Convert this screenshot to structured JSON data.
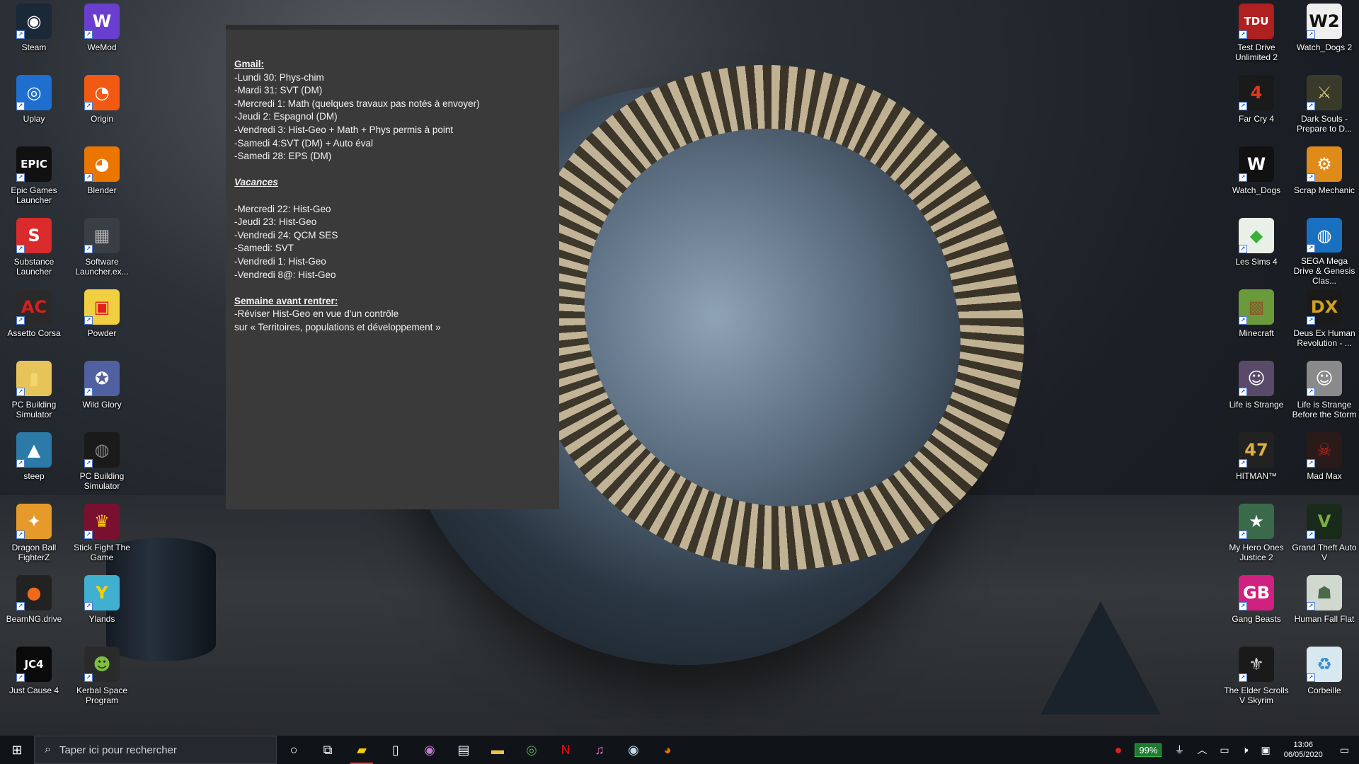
{
  "note": {
    "lines": [
      {
        "text": "Gmail:",
        "style": "h"
      },
      {
        "text": "-Lundi 30: Phys-chim",
        "style": ""
      },
      {
        "text": "-Mardi 31: SVT (DM)",
        "style": ""
      },
      {
        "text": "-Mercredi 1: Math (quelques travaux pas notés à envoyer)",
        "style": ""
      },
      {
        "text": "-Jeudi 2: Espagnol (DM)",
        "style": ""
      },
      {
        "text": "-Vendredi 3: Hist-Geo + Math + Phys permis à point",
        "style": ""
      },
      {
        "text": "-Samedi 4:SVT (DM) + Auto éval",
        "style": ""
      },
      {
        "text": "-Samedi 28: EPS (DM)",
        "style": ""
      },
      {
        "text": "",
        "style": "gap"
      },
      {
        "text": "Vacances",
        "style": "h hi"
      },
      {
        "text": "",
        "style": "gap"
      },
      {
        "text": "-Mercredi 22: Hist-Geo",
        "style": ""
      },
      {
        "text": "-Jeudi 23: Hist-Geo",
        "style": ""
      },
      {
        "text": "-Vendredi 24: QCM SES",
        "style": ""
      },
      {
        "text": "-Samedi: SVT",
        "style": ""
      },
      {
        "text": "-Vendredi 1: Hist-Geo",
        "style": ""
      },
      {
        "text": "-Vendredi 8@: Hist-Geo",
        "style": ""
      },
      {
        "text": "",
        "style": "gap"
      },
      {
        "text": "Semaine avant rentrer:",
        "style": "h"
      },
      {
        "text": "-Réviser Hist-Geo en vue d'un contrôle",
        "style": ""
      },
      {
        "text": "sur « Territoires, populations et développement »",
        "style": ""
      }
    ]
  },
  "desktop": {
    "col1": [
      {
        "label": "Steam",
        "icon": "steam-icon",
        "glyph": "◉",
        "bg": "#1b2838",
        "fg": "#ffffff"
      },
      {
        "label": "Uplay",
        "icon": "uplay-icon",
        "glyph": "◎",
        "bg": "#1e6fd0",
        "fg": "#ffffff"
      },
      {
        "label": "Epic Games Launcher",
        "icon": "epic-games-icon",
        "glyph": "EPIC",
        "bg": "#111111",
        "fg": "#ffffff"
      },
      {
        "label": "Substance Launcher",
        "icon": "substance-icon",
        "glyph": "S",
        "bg": "#d92b2b",
        "fg": "#ffffff"
      },
      {
        "label": "Assetto Corsa",
        "icon": "assetto-corsa-icon",
        "glyph": "AC",
        "bg": "#2a2a2a",
        "fg": "#d42020"
      },
      {
        "label": "PC Building Simulator",
        "icon": "folder-icon",
        "glyph": "▮",
        "bg": "#e7c45a",
        "fg": "#f5d66e"
      },
      {
        "label": "steep",
        "icon": "steep-icon",
        "glyph": "▲",
        "bg": "#2c7aa8",
        "fg": "#ffffff"
      },
      {
        "label": "Dragon Ball FighterZ",
        "icon": "dragon-ball-icon",
        "glyph": "✦",
        "bg": "#e69a2a",
        "fg": "#ffffff"
      },
      {
        "label": "BeamNG.drive",
        "icon": "beamng-icon",
        "glyph": "●",
        "bg": "#222222",
        "fg": "#f06a1a"
      },
      {
        "label": "Just Cause 4",
        "icon": "just-cause-icon",
        "glyph": "JC4",
        "bg": "#0a0a0a",
        "fg": "#ffffff"
      }
    ],
    "col2": [
      {
        "label": "WeMod",
        "icon": "wemod-icon",
        "glyph": "W",
        "bg": "#6a3fd0",
        "fg": "#ffffff"
      },
      {
        "label": "Origin",
        "icon": "origin-icon",
        "glyph": "◔",
        "bg": "#f25a14",
        "fg": "#ffffff"
      },
      {
        "label": "Blender",
        "icon": "blender-icon",
        "glyph": "◕",
        "bg": "#ea7600",
        "fg": "#ffffff"
      },
      {
        "label": "Software Launcher.ex...",
        "icon": "software-launcher-icon",
        "glyph": "▦",
        "bg": "#3a3f45",
        "fg": "#bbbbbb"
      },
      {
        "label": "Powder",
        "icon": "powder-icon",
        "glyph": "▣",
        "bg": "#f0d040",
        "fg": "#e02020"
      },
      {
        "label": "Wild Glory",
        "icon": "wild-glory-icon",
        "glyph": "✪",
        "bg": "#5060a0",
        "fg": "#ffffff"
      },
      {
        "label": "PC Building Simulator",
        "icon": "pc-building-icon",
        "glyph": "◍",
        "bg": "#1a1a1a",
        "fg": "#888888"
      },
      {
        "label": "Stick Fight The Game",
        "icon": "stick-fight-icon",
        "glyph": "♛",
        "bg": "#7a1030",
        "fg": "#ffcc00"
      },
      {
        "label": "Ylands",
        "icon": "ylands-icon",
        "glyph": "Y",
        "bg": "#3fb0d0",
        "fg": "#ffd000"
      },
      {
        "label": "Kerbal Space Program",
        "icon": "kerbal-icon",
        "glyph": "☻",
        "bg": "#2a2a2a",
        "fg": "#7cc040"
      }
    ],
    "col3": [
      {
        "label": "Test Drive Unlimited 2",
        "icon": "test-drive-icon",
        "glyph": "TDU",
        "bg": "#b02020",
        "fg": "#ffffff"
      },
      {
        "label": "Far Cry 4",
        "icon": "far-cry-icon",
        "glyph": "4",
        "bg": "#1a1a1a",
        "fg": "#e23a1a"
      },
      {
        "label": "Watch_Dogs",
        "icon": "watch-dogs-icon",
        "glyph": "W",
        "bg": "#111111",
        "fg": "#ffffff"
      },
      {
        "label": "Les Sims 4",
        "icon": "sims-icon",
        "glyph": "◆",
        "bg": "#e8f0e8",
        "fg": "#3ab03a"
      },
      {
        "label": "Minecraft",
        "icon": "minecraft-icon",
        "glyph": "▩",
        "bg": "#6a9a3a",
        "fg": "#8a5a2a"
      },
      {
        "label": "Life is Strange",
        "icon": "life-is-strange-icon",
        "glyph": "☺",
        "bg": "#5a4a6a",
        "fg": "#ffffff"
      },
      {
        "label": "HITMAN™",
        "icon": "hitman-icon",
        "glyph": "47",
        "bg": "#222222",
        "fg": "#e0b040"
      },
      {
        "label": "My Hero Ones Justice 2",
        "icon": "my-hero-icon",
        "glyph": "★",
        "bg": "#3a6a4a",
        "fg": "#ffffff"
      },
      {
        "label": "Gang Beasts",
        "icon": "gang-beasts-icon",
        "glyph": "GB",
        "bg": "#d02080",
        "fg": "#ffffff"
      },
      {
        "label": "The Elder Scrolls V Skyrim",
        "icon": "skyrim-icon",
        "glyph": "⚜",
        "bg": "#1a1a1a",
        "fg": "#dddddd"
      }
    ],
    "col4": [
      {
        "label": "Watch_Dogs 2",
        "icon": "watch-dogs-2-icon",
        "glyph": "W2",
        "bg": "#eeeeee",
        "fg": "#111111"
      },
      {
        "label": "Dark Souls - Prepare to D...",
        "icon": "dark-souls-icon",
        "glyph": "⚔",
        "bg": "#3a3a2a",
        "fg": "#d0c080"
      },
      {
        "label": "Scrap Mechanic",
        "icon": "scrap-mechanic-icon",
        "glyph": "⚙",
        "bg": "#e08a1a",
        "fg": "#ffffff"
      },
      {
        "label": "SEGA Mega Drive & Genesis Clas...",
        "icon": "sega-icon",
        "glyph": "◍",
        "bg": "#1a70c0",
        "fg": "#ffffff"
      },
      {
        "label": "Deus Ex Human Revolution - ...",
        "icon": "deus-ex-icon",
        "glyph": "DX",
        "bg": "#1a1a1a",
        "fg": "#d0a020"
      },
      {
        "label": "Life is Strange Before the Storm",
        "icon": "life-is-strange-bts-icon",
        "glyph": "☺",
        "bg": "#8a8a8a",
        "fg": "#ffffff"
      },
      {
        "label": "Mad Max",
        "icon": "mad-max-icon",
        "glyph": "☠",
        "bg": "#2a1a1a",
        "fg": "#c02020"
      },
      {
        "label": "Grand Theft Auto V",
        "icon": "gta-v-icon",
        "glyph": "V",
        "bg": "#1a2a1a",
        "fg": "#7ab040"
      },
      {
        "label": "Human Fall Flat",
        "icon": "human-fall-flat-icon",
        "glyph": "☗",
        "bg": "#d0d8d0",
        "fg": "#4a6a4a"
      },
      {
        "label": "Corbeille",
        "icon": "recycle-bin-icon",
        "glyph": "♻",
        "bg": "#d8e8f0",
        "fg": "#3a8ad0"
      }
    ]
  },
  "taskbar": {
    "search_placeholder": "Taper ici pour rechercher",
    "apps": [
      {
        "name": "start-button",
        "glyph": "⊞",
        "color": "#ffffff",
        "active": false
      },
      {
        "name": "cortana-button",
        "glyph": "○",
        "color": "#ffffff",
        "active": false
      },
      {
        "name": "task-view-button",
        "glyph": "⧉",
        "color": "#ffffff",
        "active": false
      },
      {
        "name": "sticky-notes-app",
        "glyph": "▰",
        "color": "#f5d000",
        "active": true
      },
      {
        "name": "notepad-app",
        "glyph": "▯",
        "color": "#ffffff",
        "active": false
      },
      {
        "name": "media-app",
        "glyph": "◉",
        "color": "#c07ad0",
        "active": false
      },
      {
        "name": "store-app",
        "glyph": "▤",
        "color": "#ffffff",
        "active": false
      },
      {
        "name": "file-explorer-app",
        "glyph": "▬",
        "color": "#f0c040",
        "active": false
      },
      {
        "name": "chrome-app",
        "glyph": "◎",
        "color": "#4caf50",
        "active": false
      },
      {
        "name": "netflix-app",
        "glyph": "N",
        "color": "#e50914",
        "active": false
      },
      {
        "name": "itunes-app",
        "glyph": "♫",
        "color": "#e070c0",
        "active": false
      },
      {
        "name": "steam-app",
        "glyph": "◉",
        "color": "#c0d8f0",
        "active": false
      },
      {
        "name": "blender-app",
        "glyph": "◕",
        "color": "#ea7600",
        "active": false
      }
    ],
    "battery_percent": "99%",
    "time": "13:06",
    "date": "06/05/2020"
  }
}
